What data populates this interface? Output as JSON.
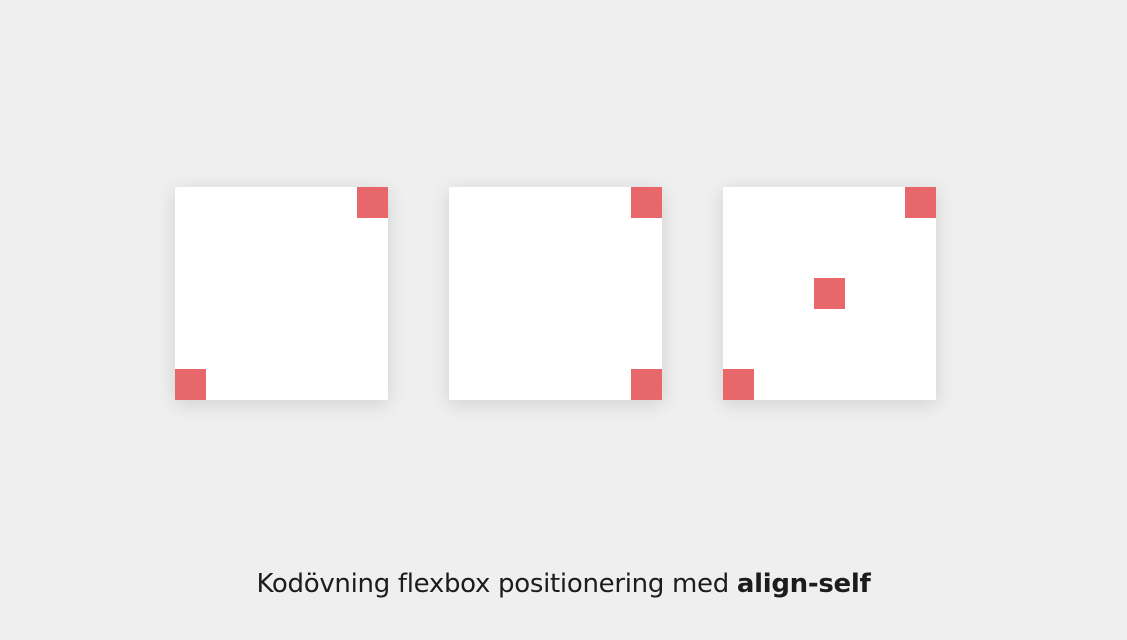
{
  "colors": {
    "background": "#efefef",
    "panel": "#ffffff",
    "square": "#e8676a",
    "text": "#1c1c1c"
  },
  "caption": {
    "text": "Kodövning flexbox positionering med ",
    "emphasis": "align-self"
  }
}
